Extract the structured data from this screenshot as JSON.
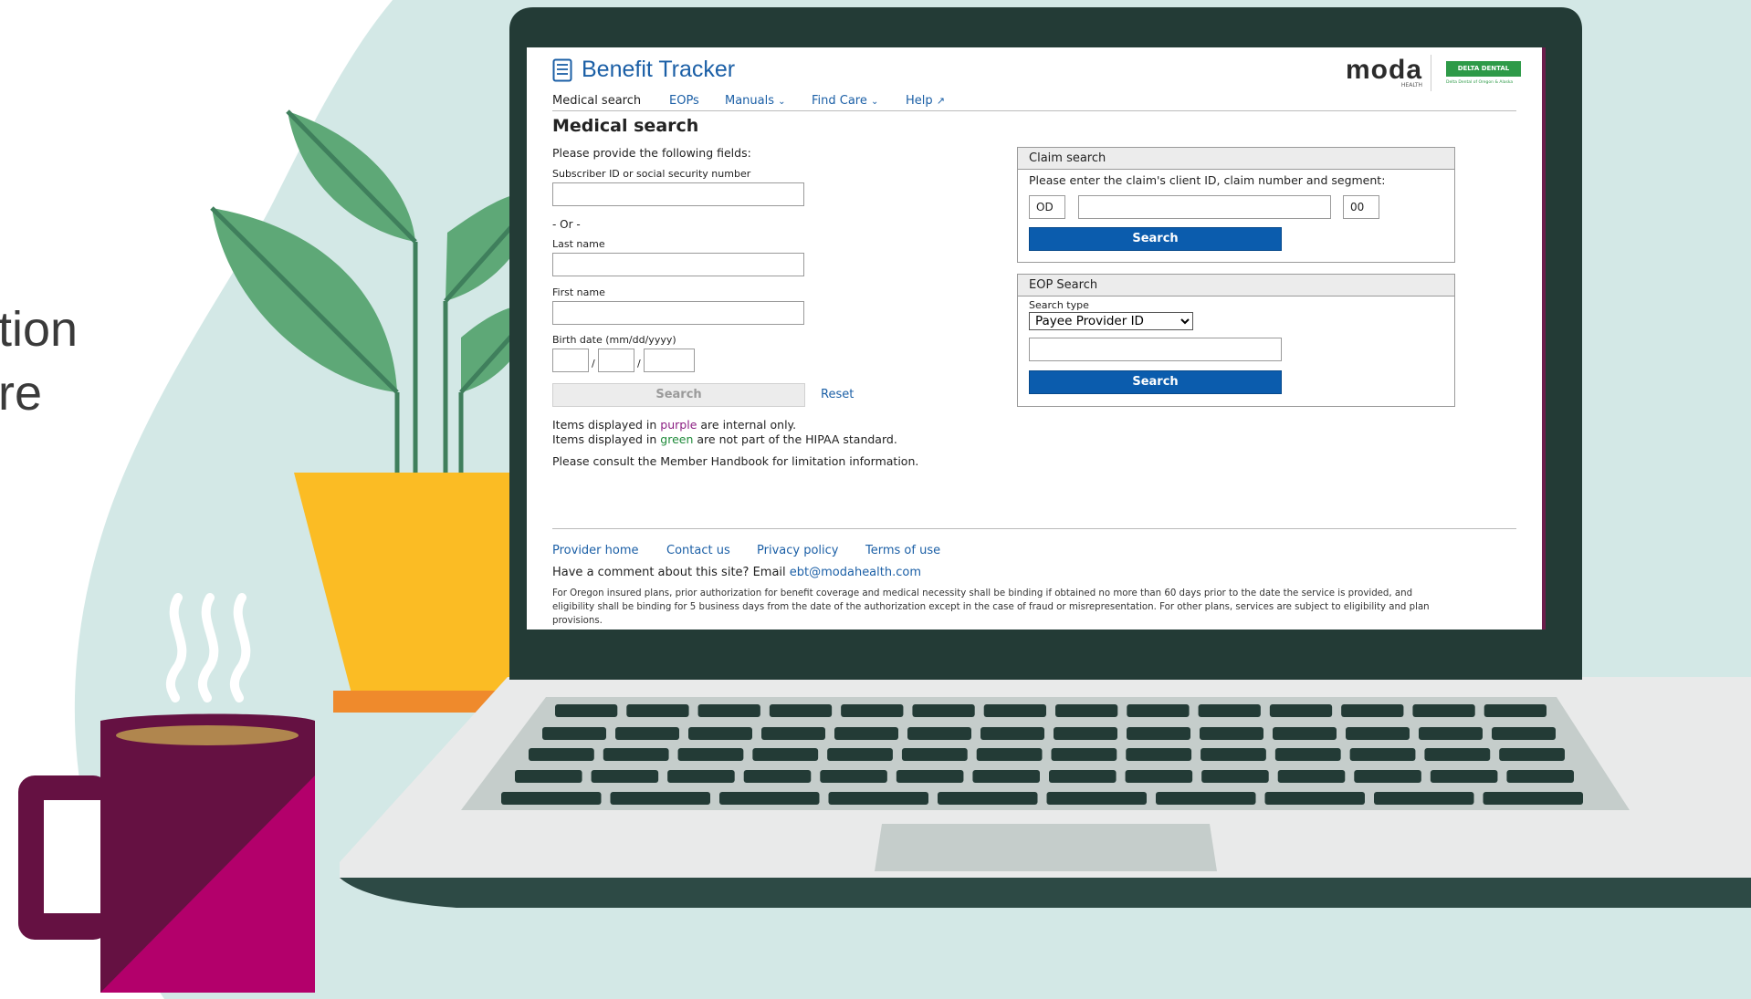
{
  "background": {
    "side_text_line1": "tion",
    "side_text_line2": "re",
    "colors": {
      "backdrop": "#d3e8e6",
      "laptop_frame": "#233b36",
      "laptop_base": "#e9eaea",
      "pot": "#fbbc24",
      "plant": "#5ea877",
      "mug_dark": "#651142",
      "mug_light": "#b3006b"
    }
  },
  "app": {
    "title": "Benefit Tracker",
    "title_icon": "document-list-icon",
    "logo_text": "moda",
    "logo_subtext": "HEALTH",
    "partner_logo_text": "DELTA DENTAL",
    "partner_logo_subtext": "Delta Dental of Oregon & Alaska",
    "accent_color": "#1b5fa6"
  },
  "nav": {
    "items": [
      {
        "label": "Medical search",
        "active": true
      },
      {
        "label": "EOPs"
      },
      {
        "label": "Manuals",
        "icon": "chevron-down-icon"
      },
      {
        "label": "Find Care",
        "icon": "chevron-down-icon"
      },
      {
        "label": "Help",
        "icon": "external-link-icon"
      }
    ]
  },
  "medical_search": {
    "heading": "Medical search",
    "instructions": "Please provide the following fields:",
    "subscriber_label": "Subscriber ID or social security number",
    "subscriber_value": "",
    "or_text": "- Or -",
    "last_name_label": "Last name",
    "last_name_value": "",
    "first_name_label": "First name",
    "first_name_value": "",
    "birth_date_label": "Birth date (mm/dd/yyyy)",
    "date_separator": "/",
    "search_label": "Search",
    "reset_label": "Reset",
    "note1_prefix": "Items displayed in ",
    "note1_highlight": "purple",
    "note1_suffix": " are internal only.",
    "note2_prefix": "Items displayed in ",
    "note2_highlight": "green",
    "note2_suffix": " are not part of the HIPAA standard.",
    "note3": "Please consult the Member Handbook for limitation information.",
    "purple_color": "#8b1e82",
    "green_color": "#1f8a3a"
  },
  "claim_search": {
    "heading": "Claim search",
    "instructions": "Please enter the claim's client ID, claim number and segment:",
    "client_id_value": "OD",
    "claim_number_value": "",
    "segment_value": "00",
    "search_label": "Search"
  },
  "eop_search": {
    "heading": "EOP Search",
    "search_type_label": "Search type",
    "search_type_selected": "Payee Provider ID",
    "value": "",
    "search_label": "Search"
  },
  "footer": {
    "links": [
      "Provider home",
      "Contact us",
      "Privacy policy",
      "Terms of use"
    ],
    "comment_text": "Have a comment about this site? Email ",
    "comment_email": "ebt@modahealth.com",
    "fine_print_line1": "For Oregon insured plans, prior authorization for benefit coverage and medical necessity shall be binding if obtained no more than 60 days prior to the date the service is provided, and",
    "fine_print_line2": "eligibility shall be binding for 5 business days from the date of the authorization except in the case of fraud or misrepresentation. For other plans, services are subject to eligibility and plan",
    "fine_print_line3": "provisions."
  }
}
